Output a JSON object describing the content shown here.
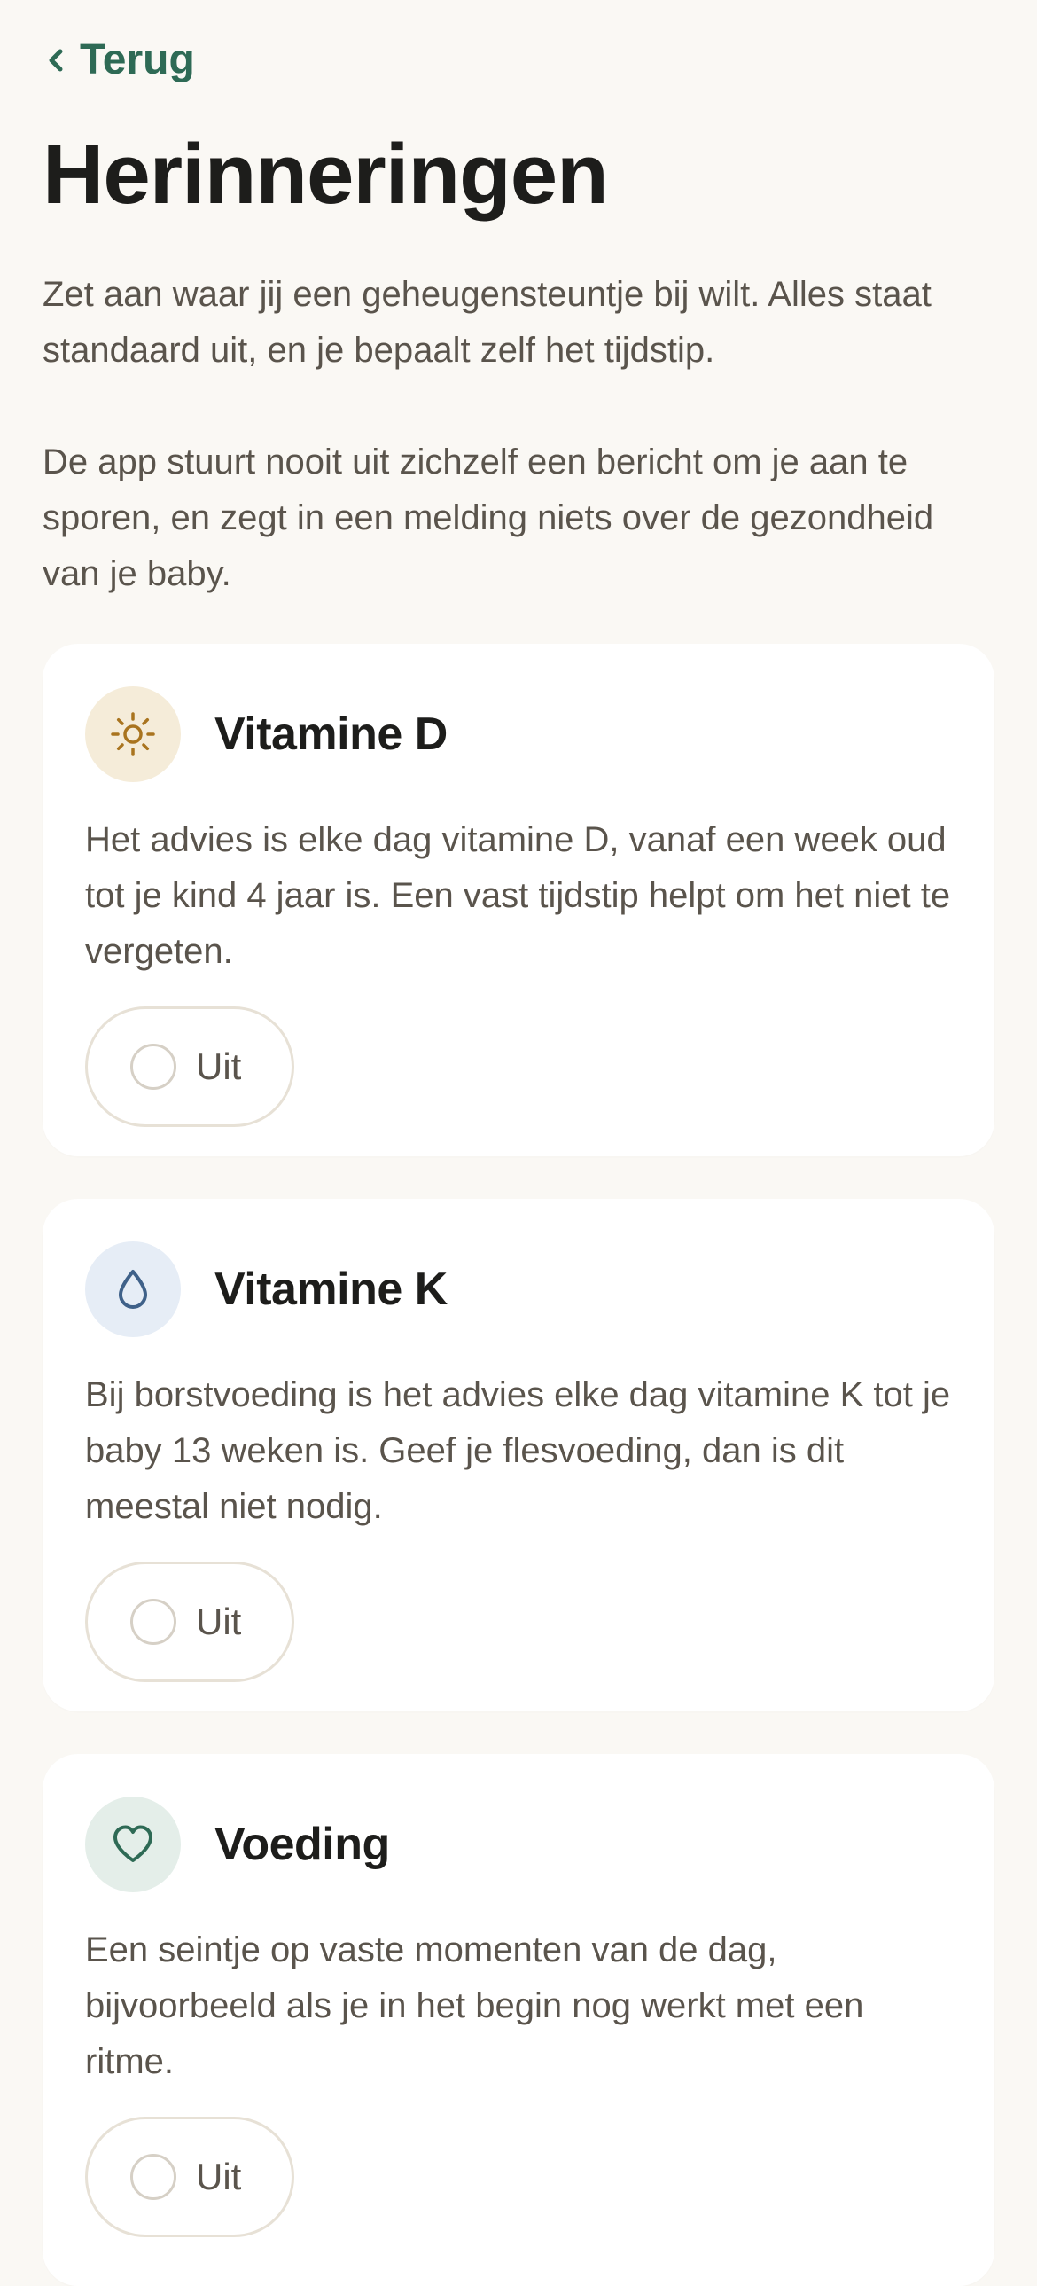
{
  "nav": {
    "back_label": "Terug"
  },
  "header": {
    "title": "Herinneringen"
  },
  "intro": {
    "paragraph_1": "Zet aan waar jij een geheugensteuntje bij wilt. Alles staat standaard uit, en je bepaalt zelf het tijdstip.",
    "paragraph_2": "De app stuurt nooit uit zichzelf een bericht om je aan te sporen, en zegt in een melding niets over de gezondheid van je baby."
  },
  "reminders": [
    {
      "icon": "sun-icon",
      "title": "Vitamine D",
      "description": "Het advies is elke dag vitamine D, vanaf een week oud tot je kind 4 jaar is. Een vast tijdstip helpt om het niet te vergeten.",
      "toggle_label": "Uit",
      "enabled": false
    },
    {
      "icon": "drop-icon",
      "title": "Vitamine K",
      "description": "Bij borstvoeding is het advies elke dag vitamine K tot je baby 13 weken is. Geef je flesvoeding, dan is dit meestal niet nodig.",
      "toggle_label": "Uit",
      "enabled": false
    },
    {
      "icon": "heart-icon",
      "title": "Voeding",
      "description": "Een seintje op vaste momenten van de dag, bijvoorbeeld als je in het begin nog werkt met een ritme.",
      "toggle_label": "Uit",
      "enabled": false
    }
  ],
  "colors": {
    "accent_green": "#2e6a55",
    "sun_icon": "#a9741f",
    "drop_icon": "#3f6189",
    "heart_icon": "#2e6a55",
    "background": "#faf8f4"
  }
}
